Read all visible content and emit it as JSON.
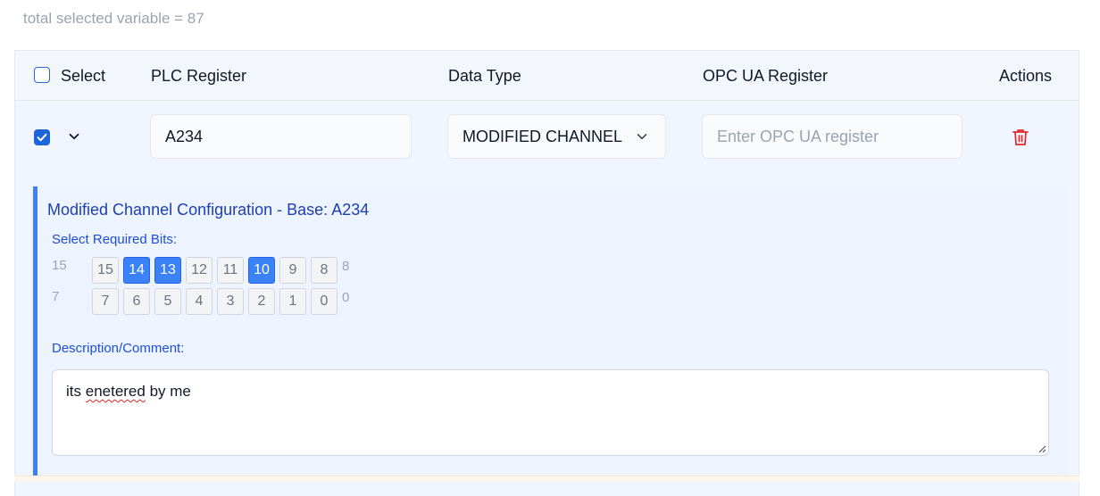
{
  "summary": {
    "total_text": "total selected variable = 87"
  },
  "table": {
    "headers": {
      "select": "Select",
      "plc_register": "PLC Register",
      "data_type": "Data Type",
      "opc_ua_register": "OPC UA Register",
      "actions": "Actions"
    },
    "row": {
      "selected": true,
      "expanded": true,
      "plc_register_value": "A234",
      "data_type_value": "MODIFIED CHANNEL",
      "opc_placeholder": "Enter OPC UA register",
      "opc_value": "",
      "delete_icon": "trash-icon"
    }
  },
  "config": {
    "title": "Modified Channel Configuration - Base: A234",
    "bits_label": "Select Required Bits:",
    "high_row": {
      "start_label": "15",
      "end_label": "8",
      "bits": [
        {
          "label": "15",
          "selected": false
        },
        {
          "label": "14",
          "selected": true
        },
        {
          "label": "13",
          "selected": true
        },
        {
          "label": "12",
          "selected": false
        },
        {
          "label": "11",
          "selected": false
        },
        {
          "label": "10",
          "selected": true
        },
        {
          "label": "9",
          "selected": false
        },
        {
          "label": "8",
          "selected": false
        }
      ]
    },
    "low_row": {
      "start_label": "7",
      "end_label": "0",
      "bits": [
        {
          "label": "7",
          "selected": false
        },
        {
          "label": "6",
          "selected": false
        },
        {
          "label": "5",
          "selected": false
        },
        {
          "label": "4",
          "selected": false
        },
        {
          "label": "3",
          "selected": false
        },
        {
          "label": "2",
          "selected": false
        },
        {
          "label": "1",
          "selected": false
        },
        {
          "label": "0",
          "selected": false
        }
      ]
    },
    "description_label": "Description/Comment:",
    "description_value_word1": "its",
    "description_value_misspelled": "enetered",
    "description_value_rest": "by me"
  },
  "colors": {
    "accent": "#3b82f6",
    "checkbox": "#1d64d8",
    "delete": "#dc2626",
    "title": "#1e40af"
  }
}
